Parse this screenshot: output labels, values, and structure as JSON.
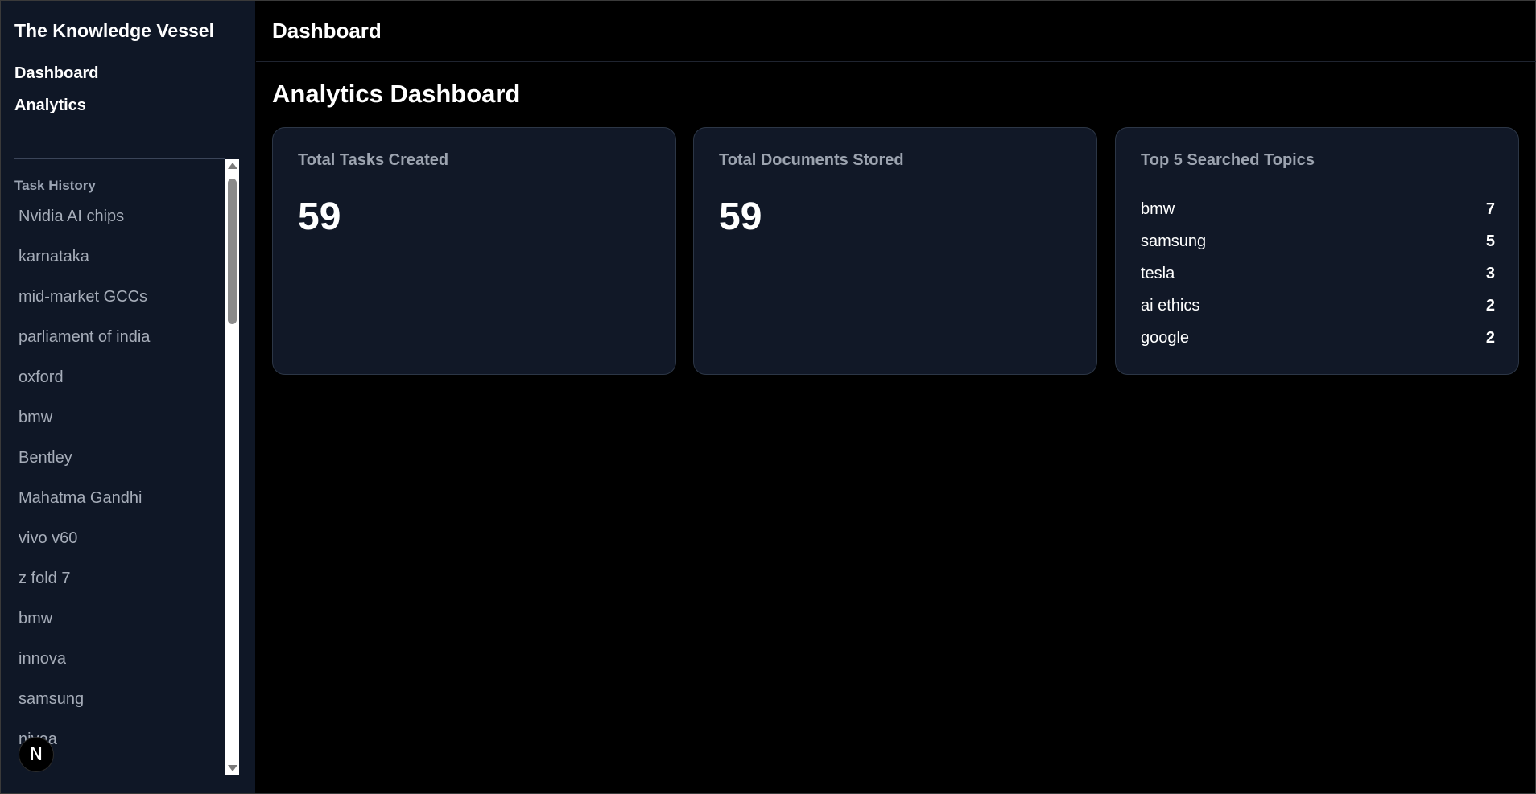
{
  "sidebar": {
    "brand": "The Knowledge Vessel",
    "nav": {
      "dashboard": "Dashboard",
      "analytics": "Analytics"
    },
    "history_title": "Task History",
    "history_items": [
      "Nvidia AI chips",
      "karnataka",
      "mid-market GCCs",
      "parliament of india",
      "oxford",
      "bmw",
      "Bentley",
      "Mahatma Gandhi",
      "vivo v60",
      "z fold 7",
      "bmw",
      "innova",
      "samsung",
      "nivea"
    ],
    "badge_letter": "N"
  },
  "header": {
    "title": "Dashboard"
  },
  "main": {
    "title": "Analytics Dashboard",
    "cards": {
      "tasks": {
        "title": "Total Tasks Created",
        "value": "59"
      },
      "documents": {
        "title": "Total Documents Stored",
        "value": "59"
      },
      "topics": {
        "title": "Top 5 Searched Topics",
        "items": [
          {
            "name": "bmw",
            "count": "7"
          },
          {
            "name": "samsung",
            "count": "5"
          },
          {
            "name": "tesla",
            "count": "3"
          },
          {
            "name": "ai ethics",
            "count": "2"
          },
          {
            "name": "google",
            "count": "2"
          }
        ]
      }
    }
  },
  "colors": {
    "sidebar_bg": "#0f1726",
    "card_bg": "#111827",
    "page_bg": "#000000",
    "muted_text": "#9ca3af"
  }
}
